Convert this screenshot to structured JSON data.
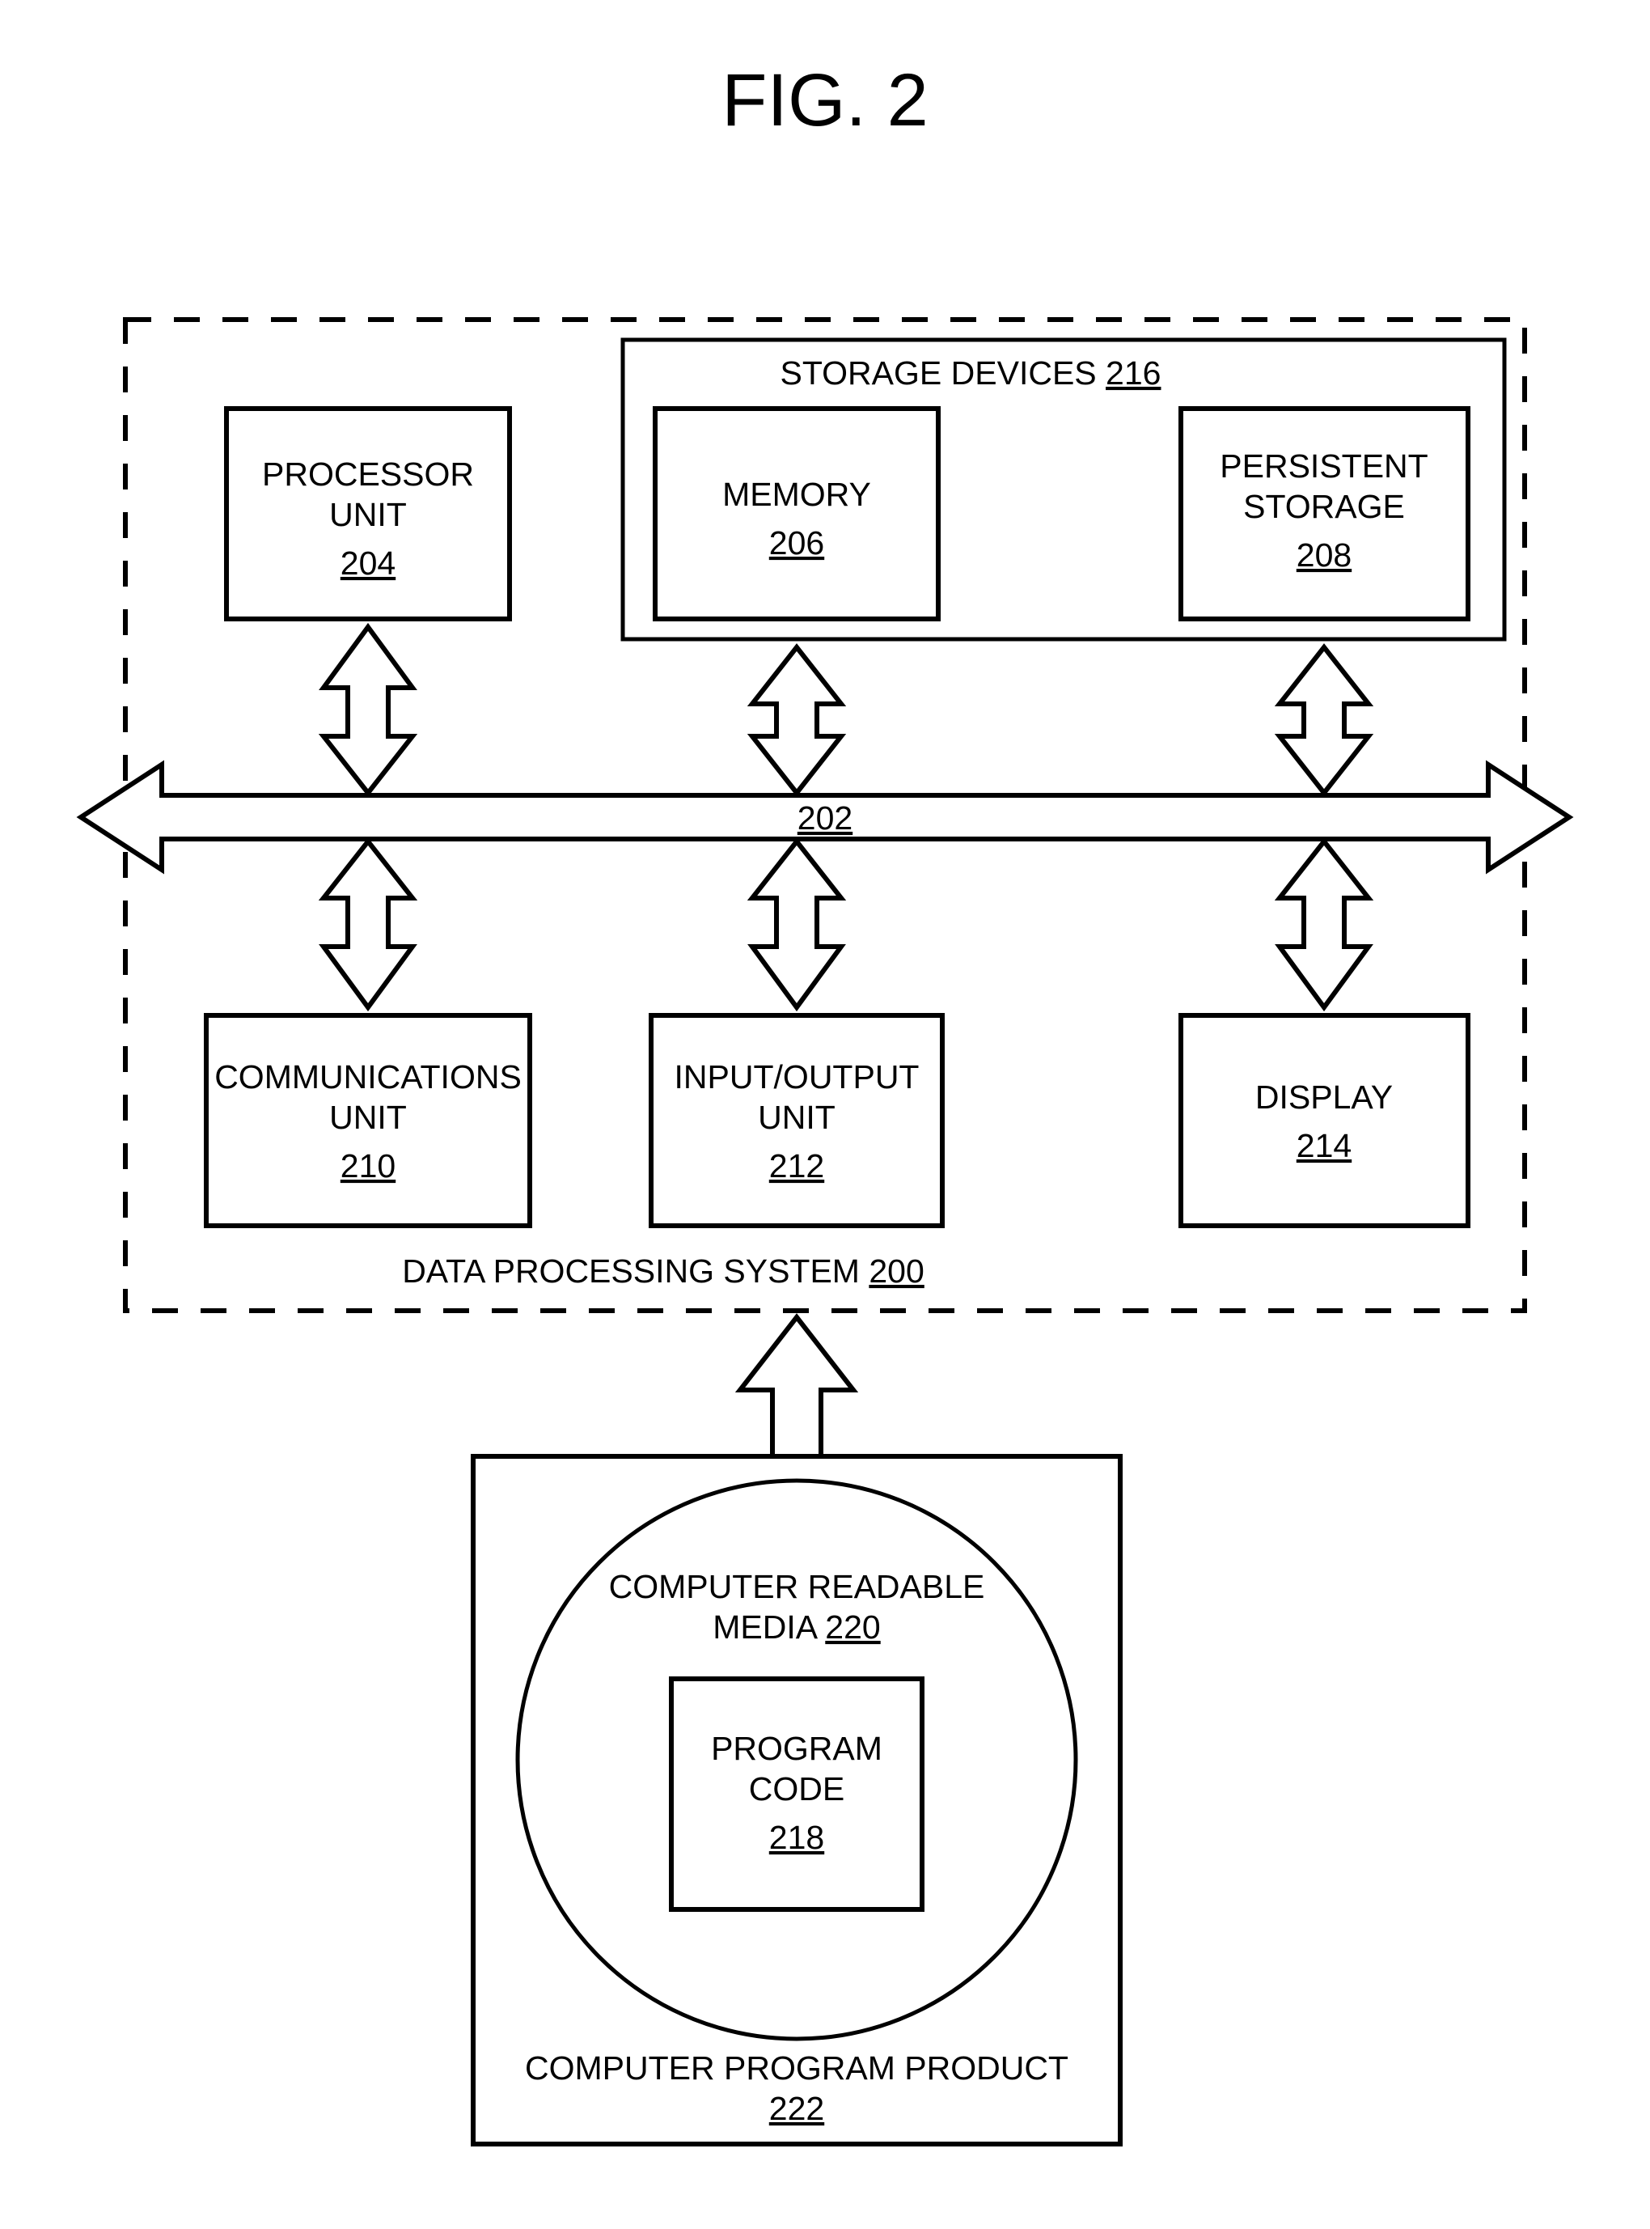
{
  "title": "FIG. 2",
  "system": {
    "label": "DATA PROCESSING SYSTEM",
    "ref": "200"
  },
  "bus": {
    "ref": "202"
  },
  "topRow": {
    "processor": {
      "line1": "PROCESSOR",
      "line2": "UNIT",
      "ref": "204"
    },
    "storage": {
      "label": "STORAGE DEVICES",
      "ref": "216"
    },
    "memory": {
      "line1": "MEMORY",
      "ref": "206"
    },
    "persist": {
      "line1": "PERSISTENT",
      "line2": "STORAGE",
      "ref": "208"
    }
  },
  "bottomRow": {
    "comm": {
      "line1": "COMMUNICATIONS",
      "line2": "UNIT",
      "ref": "210"
    },
    "io": {
      "line1": "INPUT/OUTPUT",
      "line2": "UNIT",
      "ref": "212"
    },
    "display": {
      "line1": "DISPLAY",
      "ref": "214"
    }
  },
  "product": {
    "label": "COMPUTER PROGRAM PRODUCT",
    "ref": "222",
    "media": {
      "line1": "COMPUTER READABLE",
      "line2": "MEDIA",
      "ref": "220"
    },
    "code": {
      "line1": "PROGRAM",
      "line2": "CODE",
      "ref": "218"
    }
  }
}
